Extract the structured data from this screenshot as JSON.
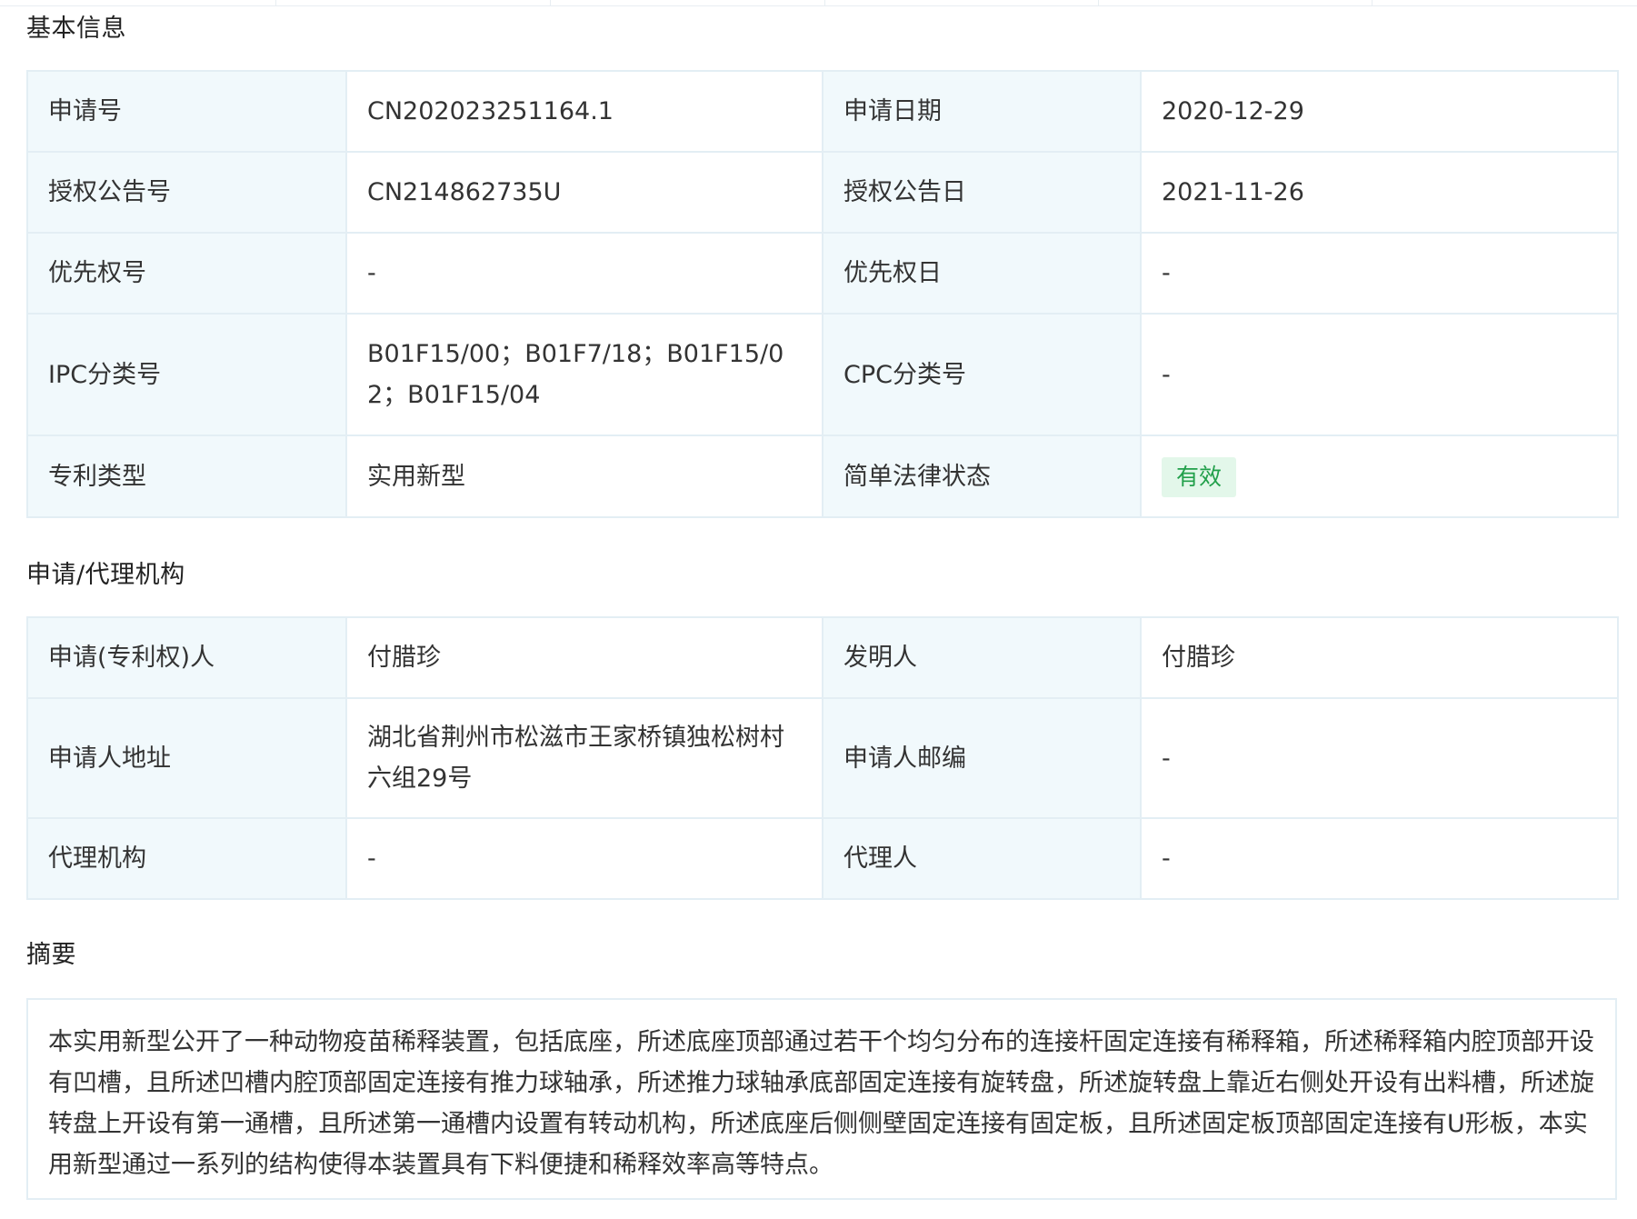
{
  "basic_info": {
    "title": "基本信息",
    "rows": [
      {
        "label1": "申请号",
        "value1": "CN202023251164.1",
        "label2": "申请日期",
        "value2": "2020-12-29"
      },
      {
        "label1": "授权公告号",
        "value1": "CN214862735U",
        "label2": "授权公告日",
        "value2": "2021-11-26"
      },
      {
        "label1": "优先权号",
        "value1": "-",
        "label2": "优先权日",
        "value2": "-"
      },
      {
        "label1": "IPC分类号",
        "value1": "B01F15/00；B01F7/18；B01F15/02；B01F15/04",
        "label2": "CPC分类号",
        "value2": "-"
      },
      {
        "label1": "专利类型",
        "value1": "实用新型",
        "label2": "简单法律状态",
        "value2": "有效"
      }
    ]
  },
  "agency": {
    "title": "申请/代理机构",
    "rows": [
      {
        "label1": "申请(专利权)人",
        "value1": "付腊珍",
        "label2": "发明人",
        "value2": "付腊珍"
      },
      {
        "label1": "申请人地址",
        "value1": "湖北省荆州市松滋市王家桥镇独松树村六组29号",
        "label2": "申请人邮编",
        "value2": "-"
      },
      {
        "label1": "代理机构",
        "value1": "-",
        "label2": "代理人",
        "value2": "-"
      }
    ]
  },
  "abstract": {
    "title": "摘要",
    "text": "本实用新型公开了一种动物疫苗稀释装置，包括底座，所述底座顶部通过若干个均匀分布的连接杆固定连接有稀释箱，所述稀释箱内腔顶部开设有凹槽，且所述凹槽内腔顶部固定连接有推力球轴承，所述推力球轴承底部固定连接有旋转盘，所述旋转盘上靠近右侧处开设有出料槽，所述旋转盘上开设有第一通槽，且所述第一通槽内设置有转动机构，所述底座后侧侧壁固定连接有固定板，且所述固定板顶部固定连接有U形板，本实用新型通过一系列的结构使得本装置具有下料便捷和稀释效率高等特点。"
  },
  "colors": {
    "label_bg": "#f1f9fc",
    "border": "#e3eef4",
    "status_bg": "#e3f7ea",
    "status_text": "#22a04b"
  }
}
